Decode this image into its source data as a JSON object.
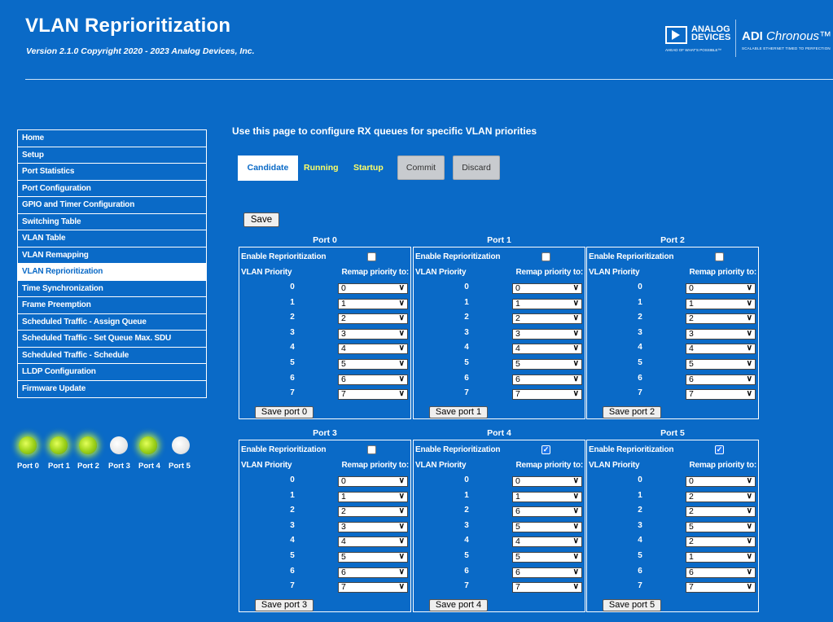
{
  "header": {
    "title": "VLAN Reprioritization",
    "version": "Version 2.1.0 Copyright 2020 - 2023 Analog Devices, Inc.",
    "logo_adi_line1": "ANALOG",
    "logo_adi_line2": "DEVICES",
    "logo_adi_tagline": "AHEAD OF WHAT'S POSSIBLE™",
    "logo_chronous_bold": "ADI",
    "logo_chronous_italic": "Chronous™",
    "logo_chronous_tagline": "SCALABLE ETHERNET TIMED TO PERFECTION"
  },
  "sidebar": {
    "items": [
      {
        "label": "Home"
      },
      {
        "label": "Setup"
      },
      {
        "label": "Port Statistics"
      },
      {
        "label": "Port Configuration"
      },
      {
        "label": "GPIO and Timer Configuration"
      },
      {
        "label": "Switching Table"
      },
      {
        "label": "VLAN Table"
      },
      {
        "label": "VLAN Remapping"
      },
      {
        "label": "VLAN Reprioritization",
        "active": true
      },
      {
        "label": "Time Synchronization"
      },
      {
        "label": "Frame Preemption"
      },
      {
        "label": "Scheduled Traffic - Assign Queue"
      },
      {
        "label": "Scheduled Traffic - Set Queue Max. SDU"
      },
      {
        "label": "Scheduled Traffic - Schedule"
      },
      {
        "label": "LLDP Configuration"
      },
      {
        "label": "Firmware Update"
      }
    ]
  },
  "port_leds": [
    {
      "label": "Port 0",
      "state": "on"
    },
    {
      "label": "Port 1",
      "state": "on"
    },
    {
      "label": "Port 2",
      "state": "on"
    },
    {
      "label": "Port 3",
      "state": "off"
    },
    {
      "label": "Port 4",
      "state": "on"
    },
    {
      "label": "Port 5",
      "state": "off"
    }
  ],
  "main": {
    "intro": "Use this page to configure RX queues for specific VLAN priorities",
    "tabs": {
      "candidate": "Candidate",
      "running": "Running",
      "startup": "Startup"
    },
    "commit_label": "Commit",
    "discard_label": "Discard",
    "save_label": "Save",
    "enable_label": "Enable Reprioritization",
    "vlan_priority_header": "VLAN Priority",
    "remap_header": "Remap priority to:",
    "priorities": [
      "0",
      "1",
      "2",
      "3",
      "4",
      "5",
      "6",
      "7"
    ]
  },
  "ports": [
    {
      "title": "Port 0",
      "enabled": false,
      "remap": [
        "0",
        "1",
        "2",
        "3",
        "4",
        "5",
        "6",
        "7"
      ],
      "save_label": "Save port 0"
    },
    {
      "title": "Port 1",
      "enabled": false,
      "remap": [
        "0",
        "1",
        "2",
        "3",
        "4",
        "5",
        "6",
        "7"
      ],
      "save_label": "Save port 1"
    },
    {
      "title": "Port 2",
      "enabled": false,
      "remap": [
        "0",
        "1",
        "2",
        "3",
        "4",
        "5",
        "6",
        "7"
      ],
      "save_label": "Save port 2"
    },
    {
      "title": "Port 3",
      "enabled": false,
      "remap": [
        "0",
        "1",
        "2",
        "3",
        "4",
        "5",
        "6",
        "7"
      ],
      "save_label": "Save port 3"
    },
    {
      "title": "Port 4",
      "enabled": true,
      "remap": [
        "0",
        "1",
        "6",
        "5",
        "4",
        "5",
        "6",
        "7"
      ],
      "save_label": "Save port 4"
    },
    {
      "title": "Port 5",
      "enabled": true,
      "remap": [
        "0",
        "2",
        "2",
        "5",
        "2",
        "1",
        "6",
        "7"
      ],
      "save_label": "Save port 5"
    }
  ],
  "colors": {
    "background": "#0a6ac7",
    "accent_text": "#ffff66",
    "led_on": "#9fd41b",
    "led_off": "#e8e8e8"
  }
}
